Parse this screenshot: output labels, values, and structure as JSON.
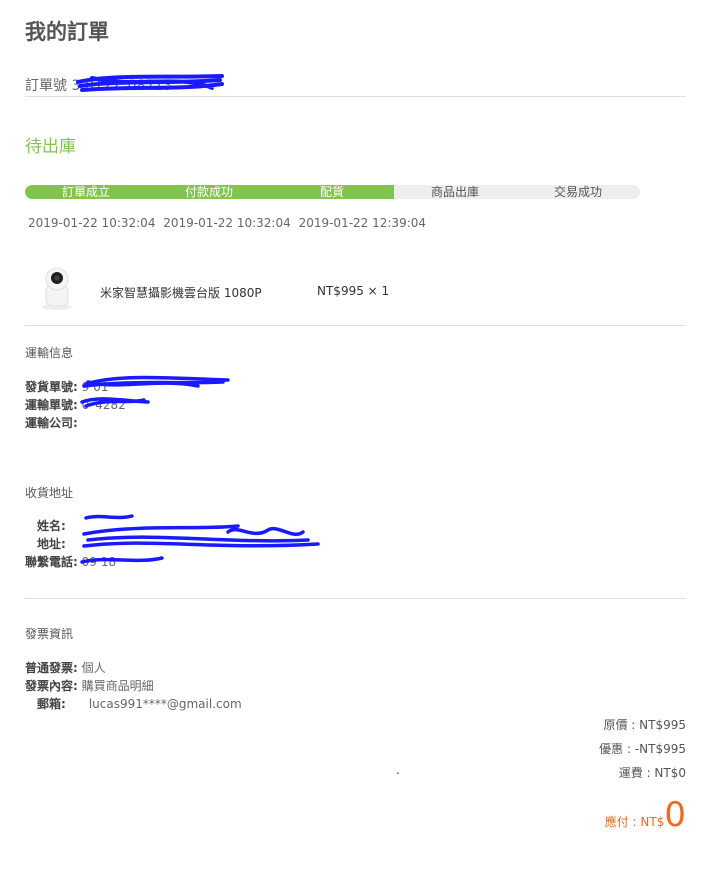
{
  "page_title": "我的訂單",
  "order": {
    "label": "訂單號",
    "number": "3  0122   08713"
  },
  "status": "待出庫",
  "progress": {
    "completed_steps": 3,
    "steps": [
      "訂單成立",
      "付款成功",
      "配貨",
      "商品出庫",
      "交易成功"
    ],
    "dates": [
      "2019-01-22 10:32:04",
      "2019-01-22 10:32:04",
      "2019-01-22 12:39:04"
    ]
  },
  "product": {
    "name": "米家智慧攝影機雲台版 1080P",
    "price_qty": "NT$995 × 1",
    "icon": "camera-product-image"
  },
  "shipping": {
    "title": "運輸信息",
    "rows": [
      {
        "key": "發貨單號:",
        "value": "9  01"
      },
      {
        "key": "運輸單號:",
        "value": "0   4282"
      },
      {
        "key": "運輸公司:",
        "value": ""
      }
    ]
  },
  "address": {
    "title": "收貨地址",
    "rows": [
      {
        "key": "姓名:",
        "value": ""
      },
      {
        "key": "地址:",
        "value": ""
      },
      {
        "key": "聯繫電話:",
        "value": "09  18"
      }
    ]
  },
  "invoice": {
    "title": "發票資訊",
    "rows": [
      {
        "key": "普通發票:",
        "value": "個人"
      },
      {
        "key": "發票內容:",
        "value": "購買商品明細"
      },
      {
        "key": "郵箱:",
        "value": "lucas991****@gmail.com"
      }
    ]
  },
  "totals": {
    "original": "原價 : NT$995",
    "discount": "優惠 : -NT$995",
    "shipping": "運費 : NT$0",
    "due_label": "應付 : NT$",
    "due_value": "0"
  },
  "dot": ".",
  "colors": {
    "accent_green": "#83c44e",
    "due_orange": "#ee6a22",
    "redaction_blue": "#1a1aff"
  }
}
